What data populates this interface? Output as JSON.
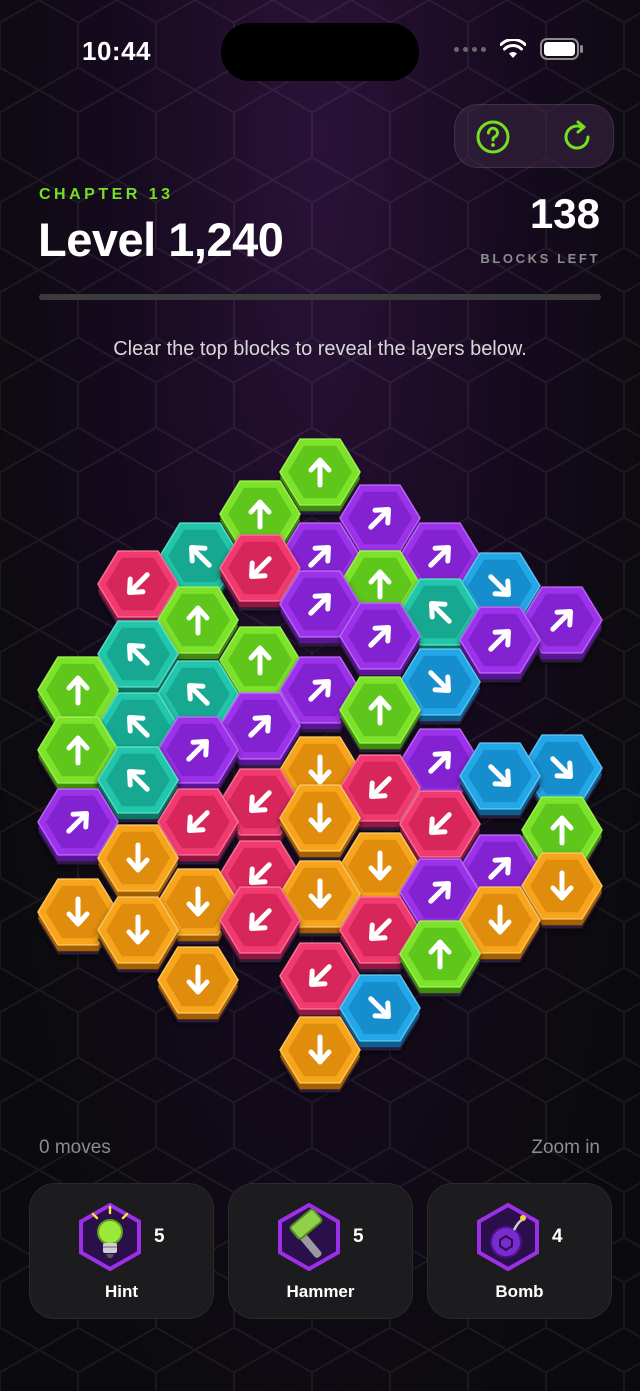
{
  "status": {
    "time": "10:44"
  },
  "header": {
    "chapter": "CHAPTER 13",
    "level": "Level 1,240",
    "blocks_left": "138",
    "blocks_left_label": "BLOCKS LEFT",
    "help_icon": "question-circle-icon",
    "restart_icon": "restart-icon"
  },
  "progress": {
    "fraction": 0.0
  },
  "instruction": "Clear the top blocks to reveal the layers below.",
  "footer": {
    "moves": "0 moves",
    "zoom": "Zoom in"
  },
  "powerups": [
    {
      "id": "hint",
      "label": "Hint",
      "count": "5",
      "icon": "lightbulb-icon"
    },
    {
      "id": "hammer",
      "label": "Hammer",
      "count": "5",
      "icon": "hammer-icon"
    },
    {
      "id": "bomb",
      "label": "Bomb",
      "count": "4",
      "icon": "bomb-icon"
    }
  ],
  "colors": {
    "green": "#78e12a",
    "purple": "#9b30e8",
    "teal": "#21c4a8",
    "pink": "#f0386f",
    "blue": "#20a6e6",
    "orange": "#f5a31c",
    "accent": "#74e021"
  },
  "board": {
    "cells": [
      {
        "c": "green",
        "d": "up"
      },
      {
        "c": "green",
        "d": "up"
      },
      {
        "c": "purple",
        "d": "upright"
      },
      {
        "c": "teal",
        "d": "upleft"
      },
      {
        "c": "pink",
        "d": "downleft"
      },
      {
        "c": "purple",
        "d": "upright"
      },
      {
        "c": "purple",
        "d": "upright"
      },
      {
        "c": "blue",
        "d": "downright"
      },
      {
        "c": "pink",
        "d": "downleft"
      },
      {
        "c": "green",
        "d": "up"
      },
      {
        "c": "purple",
        "d": "upright"
      },
      {
        "c": "green",
        "d": "up"
      },
      {
        "c": "teal",
        "d": "upleft"
      },
      {
        "c": "purple",
        "d": "upright"
      },
      {
        "c": "purple",
        "d": "upright"
      },
      {
        "c": "teal",
        "d": "upleft"
      },
      {
        "c": "green",
        "d": "up"
      },
      {
        "c": "purple",
        "d": "upright"
      },
      {
        "c": "blue",
        "d": "downright"
      },
      {
        "c": "purple",
        "d": "upright"
      },
      {
        "c": "green",
        "d": "up"
      },
      {
        "c": "teal",
        "d": "upleft"
      },
      {
        "c": "green",
        "d": "up"
      },
      {
        "c": "teal",
        "d": "upleft"
      },
      {
        "c": "purple",
        "d": "upright"
      },
      {
        "c": "green",
        "d": "up"
      },
      {
        "c": "teal",
        "d": "upleft"
      },
      {
        "c": "purple",
        "d": "upright"
      },
      {
        "c": "orange",
        "d": "down"
      },
      {
        "c": "purple",
        "d": "upright"
      },
      {
        "c": "blue",
        "d": "downright"
      },
      {
        "c": "blue",
        "d": "downright"
      },
      {
        "c": "teal",
        "d": "upleft"
      },
      {
        "c": "pink",
        "d": "downleft"
      },
      {
        "c": "pink",
        "d": "downleft"
      },
      {
        "c": "pink",
        "d": "downleft"
      },
      {
        "c": "purple",
        "d": "upright"
      },
      {
        "c": "orange",
        "d": "down"
      },
      {
        "c": "orange",
        "d": "down"
      },
      {
        "c": "pink",
        "d": "downleft"
      },
      {
        "c": "pink",
        "d": "downleft"
      },
      {
        "c": "green",
        "d": "up"
      },
      {
        "c": "orange",
        "d": "down"
      },
      {
        "c": "orange",
        "d": "down"
      },
      {
        "c": "purple",
        "d": "upright"
      },
      {
        "c": "purple",
        "d": "upright"
      },
      {
        "c": "orange",
        "d": "down"
      },
      {
        "c": "orange",
        "d": "down"
      },
      {
        "c": "orange",
        "d": "down"
      },
      {
        "c": "pink",
        "d": "downleft"
      },
      {
        "c": "orange",
        "d": "down"
      },
      {
        "c": "pink",
        "d": "downleft"
      },
      {
        "c": "orange",
        "d": "down"
      },
      {
        "c": "green",
        "d": "up"
      },
      {
        "c": "orange",
        "d": "down"
      },
      {
        "c": "pink",
        "d": "downleft"
      },
      {
        "c": "blue",
        "d": "downright"
      },
      {
        "c": "orange",
        "d": "down"
      }
    ]
  }
}
